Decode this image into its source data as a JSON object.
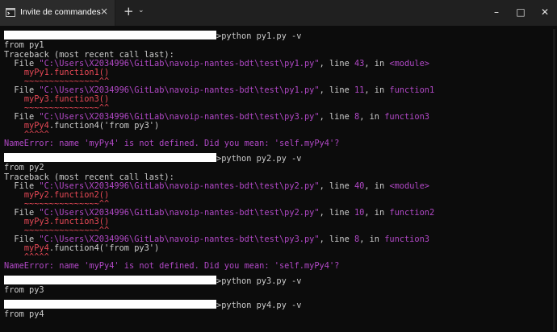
{
  "window": {
    "tab_title": "Invite de commandes",
    "tab_close": "×",
    "new_tab": "+",
    "tab_dropdown": "⌄",
    "minimize": "–",
    "maximize": "□",
    "close": "✕"
  },
  "terminal": {
    "runs": [
      {
        "command": ">python py1.py -v",
        "output": "from py1",
        "header": "Traceback (most recent call last):",
        "frames": [
          {
            "file": "\"C:\\Users\\X2034996\\GitLab\\navoip-nantes-bdt\\test\\py1.py\"",
            "line": "43",
            "func": "<module>",
            "call_obj": "myPy1",
            "call_rest": ".function1()",
            "caret": "~~~~~~~~~~~~~~~^^"
          },
          {
            "file": "\"C:\\Users\\X2034996\\GitLab\\navoip-nantes-bdt\\test\\py1.py\"",
            "line": "11",
            "func": "function1",
            "call_obj": "myPy3",
            "call_rest": ".function3()",
            "caret": "~~~~~~~~~~~~~~~^^"
          },
          {
            "file": "\"C:\\Users\\X2034996\\GitLab\\navoip-nantes-bdt\\test\\py3.py\"",
            "line": "8",
            "func": "function3",
            "call_obj": "myPy4",
            "call_rest": ".function4('from py3')",
            "caret": "^^^^^"
          }
        ],
        "error_type": "NameError:",
        "error_msg": " name 'myPy4' is not defined. Did you mean: 'self.myPy4'?"
      },
      {
        "command": ">python py2.py -v",
        "output": "from py2",
        "header": "Traceback (most recent call last):",
        "frames": [
          {
            "file": "\"C:\\Users\\X2034996\\GitLab\\navoip-nantes-bdt\\test\\py2.py\"",
            "line": "40",
            "func": "<module>",
            "call_obj": "myPy2",
            "call_rest": ".function2()",
            "caret": "~~~~~~~~~~~~~~~^^"
          },
          {
            "file": "\"C:\\Users\\X2034996\\GitLab\\navoip-nantes-bdt\\test\\py2.py\"",
            "line": "10",
            "func": "function2",
            "call_obj": "myPy3",
            "call_rest": ".function3()",
            "caret": "~~~~~~~~~~~~~~~^^"
          },
          {
            "file": "\"C:\\Users\\X2034996\\GitLab\\navoip-nantes-bdt\\test\\py3.py\"",
            "line": "8",
            "func": "function3",
            "call_obj": "myPy4",
            "call_rest": ".function4('from py3')",
            "caret": "^^^^^"
          }
        ],
        "error_type": "NameError:",
        "error_msg": " name 'myPy4' is not defined. Did you mean: 'self.myPy4'?"
      },
      {
        "command": ">python py3.py -v",
        "output": "from py3"
      },
      {
        "command": ">python py4.py -v",
        "output": "from py4"
      }
    ],
    "colors": {
      "background": "#0c0c0c",
      "text": "#cccccc",
      "magenta": "#b148c6",
      "red": "#e74856"
    }
  }
}
